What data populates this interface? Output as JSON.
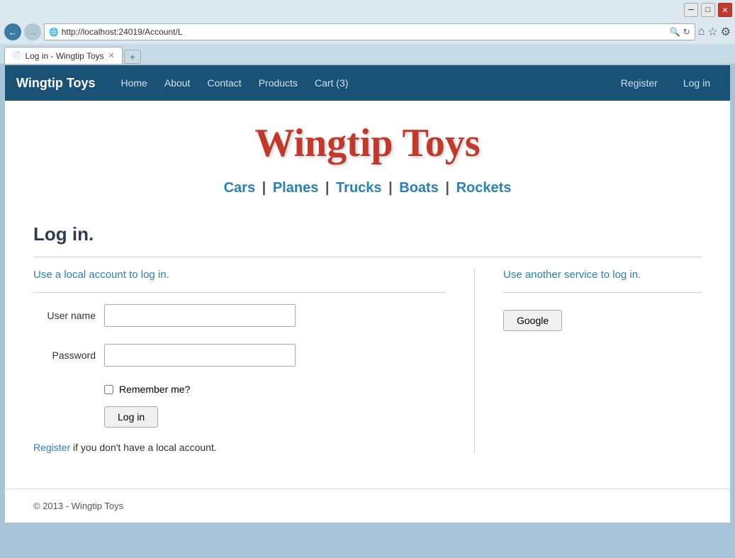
{
  "browser": {
    "title_bar": {
      "minimize": "─",
      "restore": "□",
      "close": "✕"
    },
    "address": "http://localhost:24019/Account/L",
    "tab_title": "Log in - Wingtip Toys",
    "tab_close": "✕",
    "tab_new": "+",
    "icons": {
      "home": "⌂",
      "star": "☆",
      "gear": "⚙"
    }
  },
  "nav": {
    "brand": "Wingtip Toys",
    "links": [
      "Home",
      "About",
      "Contact",
      "Products",
      "Cart (3)"
    ],
    "right_links": [
      "Register",
      "Log in"
    ]
  },
  "hero": {
    "title": "Wingtip Toys"
  },
  "categories": {
    "items": [
      "Cars",
      "Planes",
      "Trucks",
      "Boats",
      "Rockets"
    ]
  },
  "login_page": {
    "page_title": "Log in.",
    "local_section_title": "Use a local account to log in.",
    "service_section_title": "Use another service to log in.",
    "username_label": "User name",
    "password_label": "Password",
    "remember_label": "Remember me?",
    "login_button": "Log in",
    "register_prefix": "Register",
    "register_suffix": " if you don't have a local account.",
    "google_button": "Google"
  },
  "footer": {
    "text": "© 2013 - Wingtip Toys"
  }
}
